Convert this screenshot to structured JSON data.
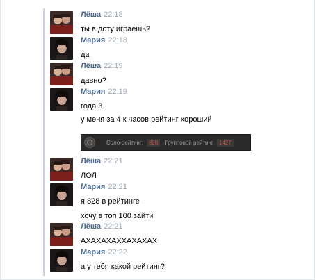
{
  "colors": {
    "name": "#4e6b8f",
    "time": "#9aa6b3",
    "rating_bg": "#2b2a2a",
    "rating_value": "#c05a4b"
  },
  "messages": [
    {
      "name": "Лёша",
      "time": "22:18",
      "avatar": "avatar-lesha",
      "lines": [
        "ты в доту играешь?"
      ]
    },
    {
      "name": "Мария",
      "time": "22:18",
      "avatar": "avatar-maria",
      "lines": [
        "да"
      ]
    },
    {
      "name": "Лёша",
      "time": "22:19",
      "avatar": "avatar-lesha",
      "lines": [
        "давно?"
      ]
    },
    {
      "name": "Мария",
      "time": "22:19",
      "avatar": "avatar-maria",
      "lines": [
        "года 3",
        "у меня за 4 к часов рейтинг хороший"
      ]
    },
    {
      "name": "Лёша",
      "time": "22:21",
      "avatar": "avatar-lesha",
      "lines": [
        "ЛОЛ"
      ]
    },
    {
      "name": "Мария",
      "time": "22:21",
      "avatar": "avatar-maria",
      "lines": [
        "я 828 в рейтинге",
        "хочу в топ 100 зайти"
      ]
    },
    {
      "name": "Лёша",
      "time": "22:21",
      "avatar": "avatar-lesha",
      "lines": [
        "АХАХАХАХХАХАХАХ"
      ]
    },
    {
      "name": "Мария",
      "time": "22:22",
      "avatar": "avatar-maria",
      "lines": [
        "а у тебя какой рейтинг?"
      ]
    }
  ],
  "rating_card": {
    "icon": "rank-medal-icon",
    "solo_label": "Соло-рейтинг:",
    "solo_value": "828",
    "group_label": "Групповой рейтинг",
    "group_value": "1427"
  }
}
